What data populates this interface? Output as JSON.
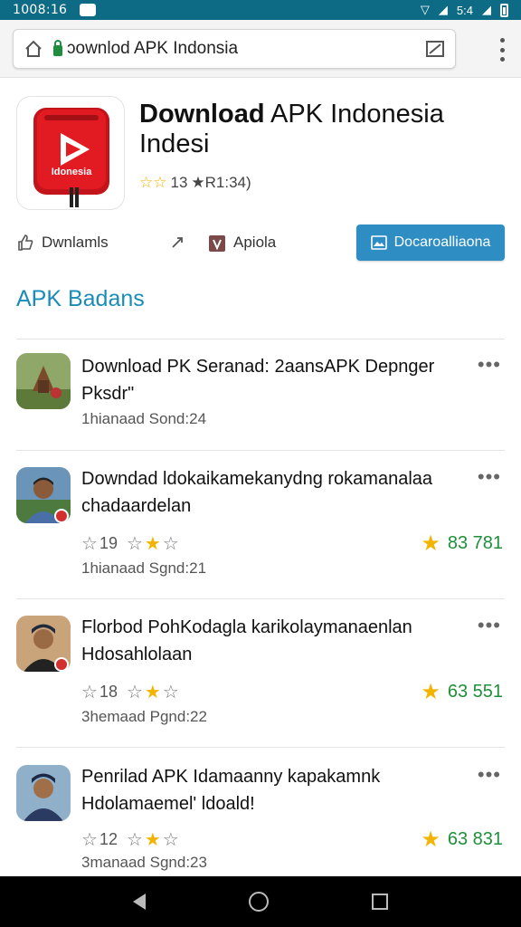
{
  "status": {
    "time": "1008:16",
    "right_text": "5:4"
  },
  "browser": {
    "url": "ɔownlod APK Indonsia"
  },
  "app": {
    "title_bold": "Download",
    "title_rest": " APK Indonesia",
    "title_line2": "Indesi",
    "icon_text": "Idonesia",
    "rating_count": "13",
    "rating_extra": "★R1:34)",
    "brand_color": "#e21b23"
  },
  "actions": {
    "downloads_label": "Dwnlamls",
    "apiola_label": "Apiola",
    "primary_label": "Docaroalliaona",
    "primary_color": "#2e8ec4"
  },
  "section": {
    "title": "APK Badans"
  },
  "list": [
    {
      "title": "Download PK Seranad: 2aansAPK Depnger Pksdr\"",
      "stars_count": "",
      "score": "",
      "meta": "1hianaad Sond:24"
    },
    {
      "title": "Downdad ldokaikamekanydng rokamanalaa chadaardelan",
      "stars_count": "19",
      "score": "83 781",
      "meta": "1hianaad Sgnd:21"
    },
    {
      "title": "Florbod PohKodagla karikolaymanaenlan Hdosahlolaan",
      "stars_count": "18",
      "score": "63 551",
      "meta": "3hemaad Pgnd:22"
    },
    {
      "title": "Penrilad APK Idamaanny kapakamnk Hdolamaemel' ldoald!",
      "stars_count": "12",
      "score": "63 831",
      "meta": "3manaad Sgnd:23"
    }
  ],
  "more_label": "•••"
}
